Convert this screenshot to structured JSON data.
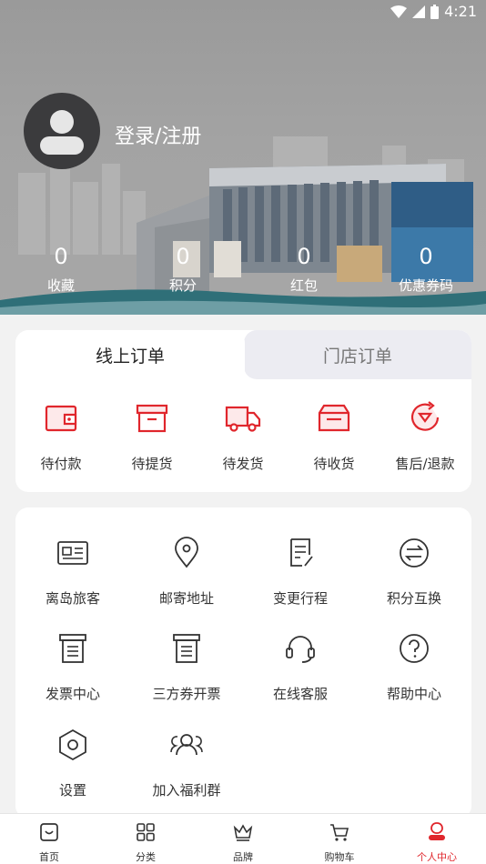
{
  "status_bar": {
    "time": "4:21"
  },
  "profile": {
    "login_label": "登录/注册"
  },
  "stats": [
    {
      "value": "0",
      "label": "收藏"
    },
    {
      "value": "0",
      "label": "积分"
    },
    {
      "value": "0",
      "label": "红包"
    },
    {
      "value": "0",
      "label": "优惠券码"
    }
  ],
  "order_tabs": {
    "online": "线上订单",
    "store": "门店订单"
  },
  "order_items": [
    {
      "label": "待付款",
      "icon": "wallet-icon"
    },
    {
      "label": "待提货",
      "icon": "box-icon"
    },
    {
      "label": "待发货",
      "icon": "truck-icon"
    },
    {
      "label": "待收货",
      "icon": "package-icon"
    },
    {
      "label": "售后/退款",
      "icon": "refund-icon"
    }
  ],
  "services": [
    {
      "label": "离岛旅客",
      "icon": "id-card-icon"
    },
    {
      "label": "邮寄地址",
      "icon": "location-icon"
    },
    {
      "label": "变更行程",
      "icon": "edit-document-icon"
    },
    {
      "label": "积分互换",
      "icon": "exchange-icon"
    },
    {
      "label": "发票中心",
      "icon": "invoice-icon"
    },
    {
      "label": "三方券开票",
      "icon": "voucher-invoice-icon"
    },
    {
      "label": "在线客服",
      "icon": "headset-icon"
    },
    {
      "label": "帮助中心",
      "icon": "help-icon"
    },
    {
      "label": "设置",
      "icon": "settings-icon"
    },
    {
      "label": "加入福利群",
      "icon": "group-icon"
    }
  ],
  "bottom_nav": [
    {
      "label": "首页",
      "icon": "home-icon"
    },
    {
      "label": "分类",
      "icon": "category-icon"
    },
    {
      "label": "品牌",
      "icon": "crown-icon"
    },
    {
      "label": "购物车",
      "icon": "cart-icon"
    },
    {
      "label": "个人中心",
      "icon": "profile-icon",
      "active": true
    }
  ],
  "colors": {
    "accent": "#e0262c",
    "hero_bg": "#a3a3a3",
    "card_bg": "#ffffff"
  }
}
